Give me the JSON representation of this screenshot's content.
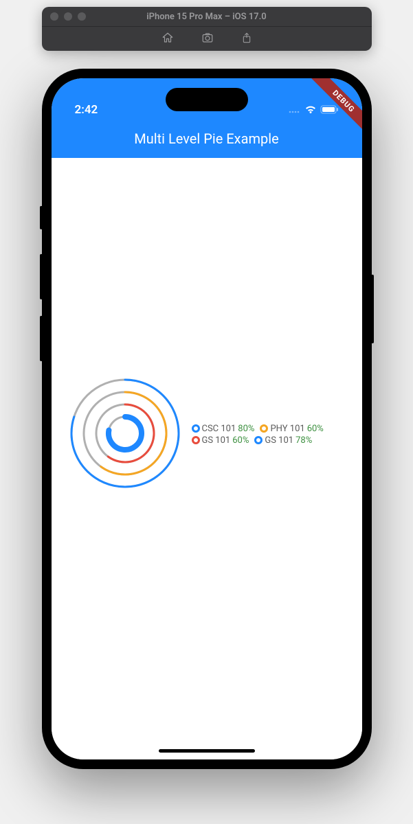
{
  "simulator": {
    "title": "iPhone 15 Pro Max – iOS 17.0"
  },
  "status_bar": {
    "time": "2:42"
  },
  "app_bar": {
    "title": "Multi Level Pie Example"
  },
  "debug_banner": "DEBUG",
  "colors": {
    "blue": "#1e88ff",
    "orange": "#f5a623",
    "red": "#e84c3d",
    "grey": "#b0b0b0",
    "green": "#3d9040"
  },
  "chart_data": {
    "type": "pie",
    "title": "Multi Level Pie Example",
    "rings": [
      {
        "label": "CSC 101",
        "percent": 80,
        "color": "#1e88ff",
        "track": "#b0b0b0"
      },
      {
        "label": "PHY 101",
        "percent": 60,
        "color": "#f5a623",
        "track": "#b0b0b0"
      },
      {
        "label": "GS 101",
        "percent": 60,
        "color": "#e84c3d",
        "track": "#b0b0b0"
      },
      {
        "label": "GS 101",
        "percent": 78,
        "color": "#1e88ff",
        "track": "#b0b0b0"
      }
    ]
  },
  "legend": [
    {
      "label": "CSC 101",
      "percent": "80%",
      "color": "#1e88ff"
    },
    {
      "label": "PHY 101",
      "percent": "60%",
      "color": "#f5a623"
    },
    {
      "label": "GS 101",
      "percent": "60%",
      "color": "#e84c3d"
    },
    {
      "label": "GS 101",
      "percent": "78%",
      "color": "#1e88ff"
    }
  ]
}
